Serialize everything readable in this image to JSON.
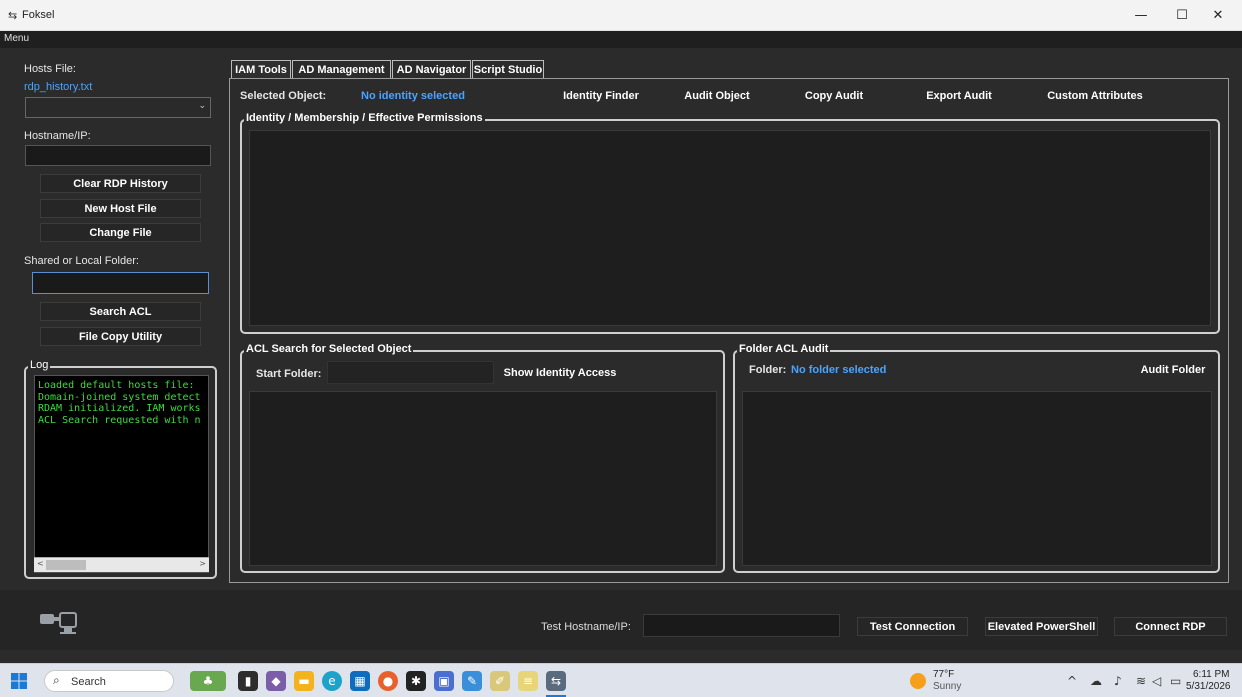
{
  "window": {
    "title": "Foksel",
    "menu": "Menu"
  },
  "sidebar": {
    "hosts_label": "Hosts File:",
    "hosts_file": "rdp_history.txt",
    "hostname_label": "Hostname/IP:",
    "buttons": {
      "clear": "Clear RDP History",
      "new_host": "New Host File",
      "change": "Change File"
    },
    "folder_label": "Shared or Local Folder:",
    "search_acl": "Search ACL",
    "file_copy": "File Copy Utility",
    "log_title": "Log",
    "log_lines": [
      "Loaded default hosts file:",
      "Domain-joined system detect",
      "RDAM initialized. IAM works",
      "ACL Search requested with n"
    ]
  },
  "tabs": [
    "IAM Tools",
    "AD Management",
    "AD Navigator",
    "Script Studio"
  ],
  "iam": {
    "selected_label": "Selected Object:",
    "selected_value": "No identity selected",
    "actions": [
      "Identity Finder",
      "Audit Object",
      "Copy Audit",
      "Export Audit",
      "Custom Attributes"
    ],
    "identity_group": "Identity / Membership / Effective Permissions",
    "acl_group": "ACL Search for Selected Object",
    "start_folder_label": "Start Folder:",
    "show_access": "Show Identity Access",
    "folder_group": "Folder ACL Audit",
    "folder_label": "Folder:",
    "folder_value": "No folder selected",
    "audit_folder": "Audit Folder"
  },
  "bottom": {
    "test_label": "Test Hostname/IP:",
    "test_connection": "Test Connection",
    "elevated_ps": "Elevated PowerShell",
    "connect_rdp": "Connect RDP"
  },
  "taskbar": {
    "search": "Search",
    "weather_temp": "77°F",
    "weather_desc": "Sunny",
    "time": "6:11 PM",
    "date": "5/31/2026"
  }
}
